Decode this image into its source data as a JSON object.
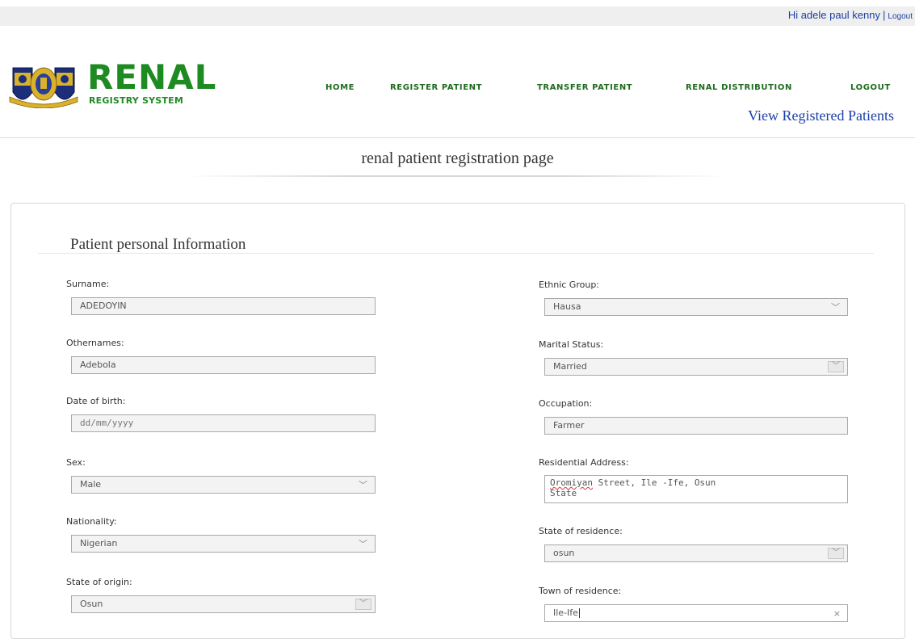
{
  "user_bar": {
    "greeting": "Hi adele paul kenny",
    "separator": "|",
    "logout_label": "Logout"
  },
  "brand": {
    "name": "RENAL",
    "subtitle": "REGISTRY SYSTEM"
  },
  "nav": {
    "home": "HOME",
    "register_patient": "REGISTER PATIENT",
    "transfer_patient": "TRANSFER PATIENT",
    "renal_distribution": "RENAL DISTRIBUTION",
    "logout": "LOGOUT",
    "view_registered": "View Registered Patients"
  },
  "page_title": "renal patient registration page",
  "section_title": "Patient personal Information",
  "form": {
    "surname": {
      "label": "Surname:",
      "value": "ADEDOYIN"
    },
    "othernames": {
      "label": "Othernames:",
      "value": "Adebola"
    },
    "dob": {
      "label": "Date of birth:",
      "placeholder": "dd/mm/yyyy"
    },
    "sex": {
      "label": "Sex:",
      "value": "Male"
    },
    "nationality": {
      "label": "Nationality:",
      "value": "Nigerian"
    },
    "state_of_origin": {
      "label": "State of origin:",
      "value": "Osun"
    },
    "ethnic_group": {
      "label": "Ethnic Group:",
      "value": "Hausa"
    },
    "marital_status": {
      "label": "Marital Status:",
      "value": "Married"
    },
    "occupation": {
      "label": "Occupation:",
      "value": "Farmer"
    },
    "residential_address": {
      "label": "Residential Address:",
      "value_word1": "Oromiyan",
      "value_rest": " Street, Ile -Ife, Osun",
      "value_line2": "State"
    },
    "state_of_residence": {
      "label": "State of residence:",
      "value": "osun"
    },
    "town_of_residence": {
      "label": "Town of residence:",
      "value": "Ile-Ife"
    }
  },
  "icons": {
    "chevron": "chevron-down-icon",
    "clear": "clear-x-icon"
  },
  "colors": {
    "brand_green": "#1e8a22",
    "link_blue": "#1a3fa8"
  }
}
